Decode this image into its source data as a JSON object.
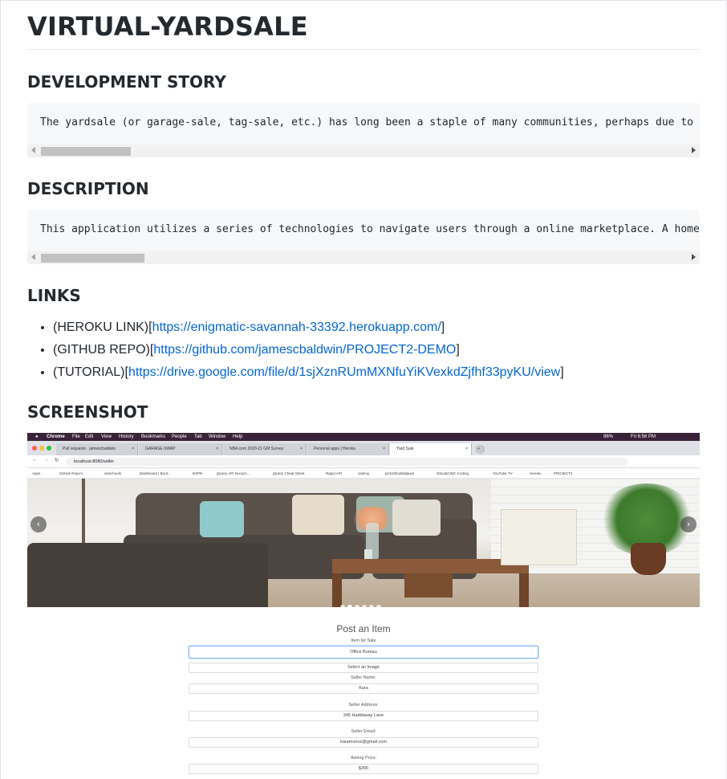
{
  "readme": {
    "title": "VIRTUAL-YARDSALE",
    "sections": {
      "development_story": {
        "heading": "DEVELOPMENT STORY",
        "code": "The yardsale (or garage-sale, tag-sale, etc.) has long been a staple of many communities, perhaps due to what"
      },
      "description": {
        "heading": "DESCRIPTION",
        "code": "This application utilizes a series of technologies to navigate users through a online marketplace. A homepage"
      },
      "links": {
        "heading": "LINKS",
        "items": [
          {
            "prefix": "(HEROKU LINK)[",
            "url": "https://enigmatic-savannah-33392.herokuapp.com/",
            "suffix": "]"
          },
          {
            "prefix": "(GITHUB REPO)[",
            "url": "https://github.com/jamescbaldwin/PROJECT2-DEMO",
            "suffix": "]"
          },
          {
            "prefix": "(TUTORIAL)[",
            "url": "https://drive.google.com/file/d/1sjXznRUmMXNfuYiKVexkdZjfhf33pyKU/view",
            "suffix": "]"
          }
        ]
      },
      "screenshot": {
        "heading": "SCREENSHOT"
      }
    }
  },
  "screenshot_image": {
    "menubar": {
      "app": "Chrome",
      "menus": [
        "File",
        "Edit",
        "View",
        "History",
        "Bookmarks",
        "People",
        "Tab",
        "Window",
        "Help"
      ],
      "battery": "96%",
      "clock": "Fri 6:56 PM"
    },
    "tabs": [
      {
        "label": "Pull requests · jamescbaldwin",
        "active": false
      },
      {
        "label": "GARAGE-SWAP",
        "active": false
      },
      {
        "label": "NBA.com 2020-21 GM Survey",
        "active": false
      },
      {
        "label": "Personal apps | Heroku",
        "active": false
      },
      {
        "label": "Yard Sale",
        "active": true
      }
    ],
    "address": "localhost:8080/seller",
    "bookmarks": [
      "Apps",
      "GitHub Repo's",
      "w3schools",
      "Dashboard | Boot...",
      "ESPN",
      "jQuery API Docum...",
      "jQuery Cheat Sheet",
      "Rapid API",
      "Udemy",
      "pick10footballpool",
      "GitLab/UNC-Coding",
      "YouTube TV",
      "Heroku",
      "PROJECT2"
    ],
    "carousel": {
      "prev": "‹",
      "next": "›",
      "slides": 6,
      "active_slide": 1
    },
    "form": {
      "title": "Post an Item",
      "fields": [
        {
          "label": "Item for Sale",
          "value": "Office Bureau"
        },
        {
          "label": "",
          "value": "Select an Image"
        },
        {
          "label": "Seller Name:",
          "value": "Kara"
        },
        {
          "label": "Seller Address:",
          "value": "345 Haddaway Lane"
        },
        {
          "label": "Seller Email:",
          "value": "karamunoz@gmail.com"
        },
        {
          "label": "Asking Price:",
          "value": "$300"
        }
      ]
    }
  },
  "colors": {
    "link": "#0366d6",
    "code_bg": "#f6f8fa",
    "menubar": "#3a2338"
  }
}
